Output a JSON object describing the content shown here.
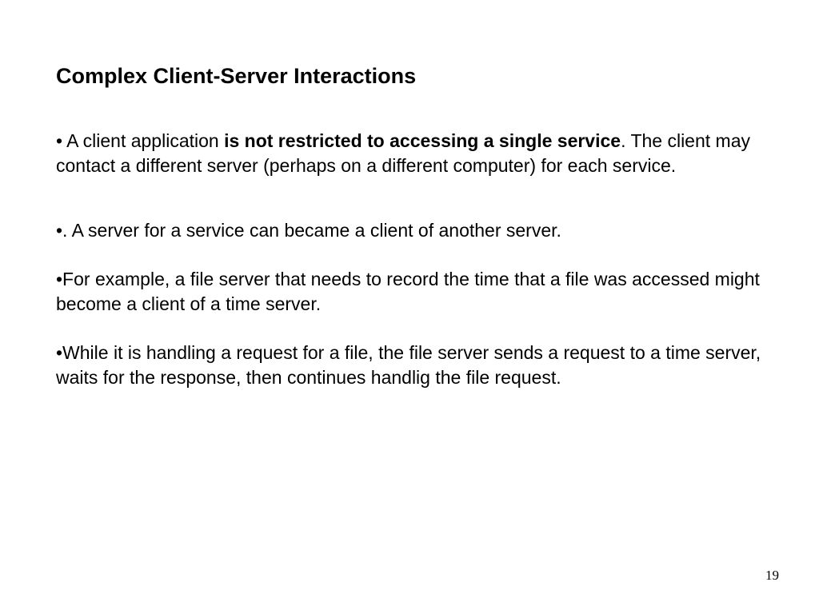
{
  "title": "Complex Client-Server Interactions",
  "bullets": {
    "b1": {
      "prefix": "• A client application ",
      "bold": "is not restricted to accessing a single service",
      "suffix": ". The client may contact a different server (perhaps on a different computer) for each service."
    },
    "b2": "•. A server for a service can became a client of another server.",
    "b3": "•For example, a file server that needs to record the time that a file was accessed might become a client of a time server.",
    "b4": "•While it is handling a request for a file, the file server sends a request to a time server, waits for the response, then continues handlig the file request."
  },
  "page_number": "19"
}
